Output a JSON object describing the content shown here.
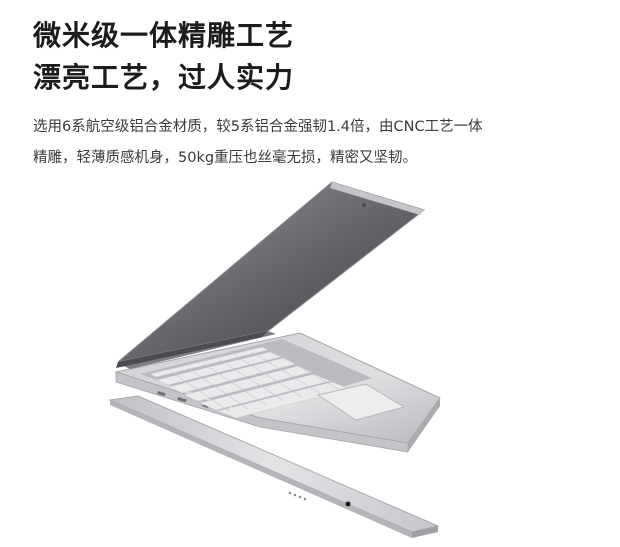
{
  "headline": {
    "line1": "微米级一体精雕工艺",
    "line2": "漂亮工艺，过人实力"
  },
  "description": {
    "line1": "选用6系航空级铝合金材质，较5系铝合金强韧1.4倍，由CNC工艺一体",
    "line2": "精雕，轻薄质感机身，50kg重压也丝毫无损，精密又坚韧。"
  },
  "colors": {
    "text_dark": "#1c1c1c",
    "text_body": "#3a3a3a",
    "aluminum_light": "#e4e5e7",
    "aluminum_mid": "#c9cacd",
    "aluminum_dark": "#8d8f94",
    "screen_dark": "#3c3d42"
  },
  "icons": [
    "laptop-illustration",
    "keyboard-icon",
    "touchpad-icon",
    "hinge-icon",
    "usb-port-icon",
    "hdmi-port-icon",
    "vent-icon"
  ]
}
